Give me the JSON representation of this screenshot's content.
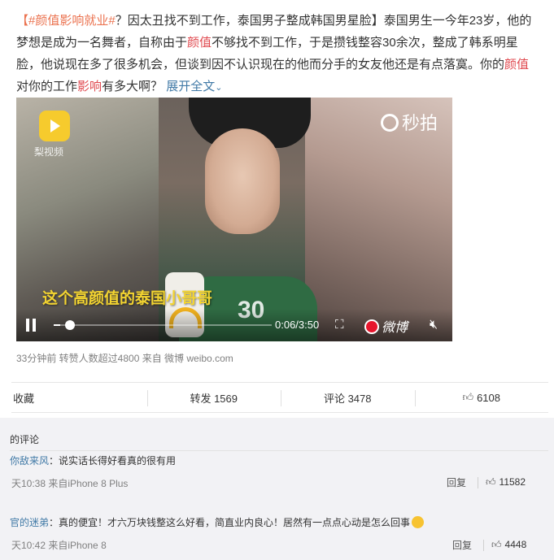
{
  "post": {
    "topic": "【#颜值影响就业#",
    "seg1": "？因太丑找不到工作，泰国男子整成韩国男星脸】泰国男生一今年23岁，他的梦想是成为一名舞者，自称由于",
    "hl1": "颜值",
    "seg2": "不够找不到工作，于是攒钱整容30余次，整成了韩系明星脸，他说现在多了很多机会，但谈到因不认识现在的他而分手的女友他还是有点落寞。你的",
    "hl2": "颜值",
    "seg3": "对你的工作",
    "hl3": "影响",
    "seg4": "有多大啊？ ",
    "expand": "展开全文",
    "expand_icon": "chevron-down-icon"
  },
  "video": {
    "source_name": "梨视频",
    "watermark": "秒拍",
    "subtitle": "这个高颜值的泰国小哥哥",
    "jersey_text": "30",
    "time": "0:06/3:50",
    "progress": 0.03,
    "brand": "微博"
  },
  "meta": {
    "text": "33分钟前 转赞人数超过4800 来自 微博 weibo.com"
  },
  "actions": {
    "favorite": "收藏",
    "repost": "转发 1569",
    "comment": "评论 3478",
    "likes": "6108"
  },
  "comments_section": {
    "heading": "的评论",
    "items": [
      {
        "user": "你敌来风",
        "text": "：说实话长得好看真的很有用",
        "time": "天10:38 来自iPhone 8 Plus",
        "reply": "回复",
        "likes": "11582"
      },
      {
        "user": "官的迷弟",
        "text": "：真的便宜！才六万块钱整这么好看，简直业内良心！居然有一点点心动是怎么回事",
        "time": "天10:42 来自iPhone 8",
        "reply": "回复",
        "likes": "4448"
      }
    ]
  },
  "colors": {
    "topic": "#eb7350",
    "highlight": "#e0494f",
    "link": "#4079a6",
    "subtitle": "#f3d431",
    "weibo_red": "#e6162d"
  }
}
